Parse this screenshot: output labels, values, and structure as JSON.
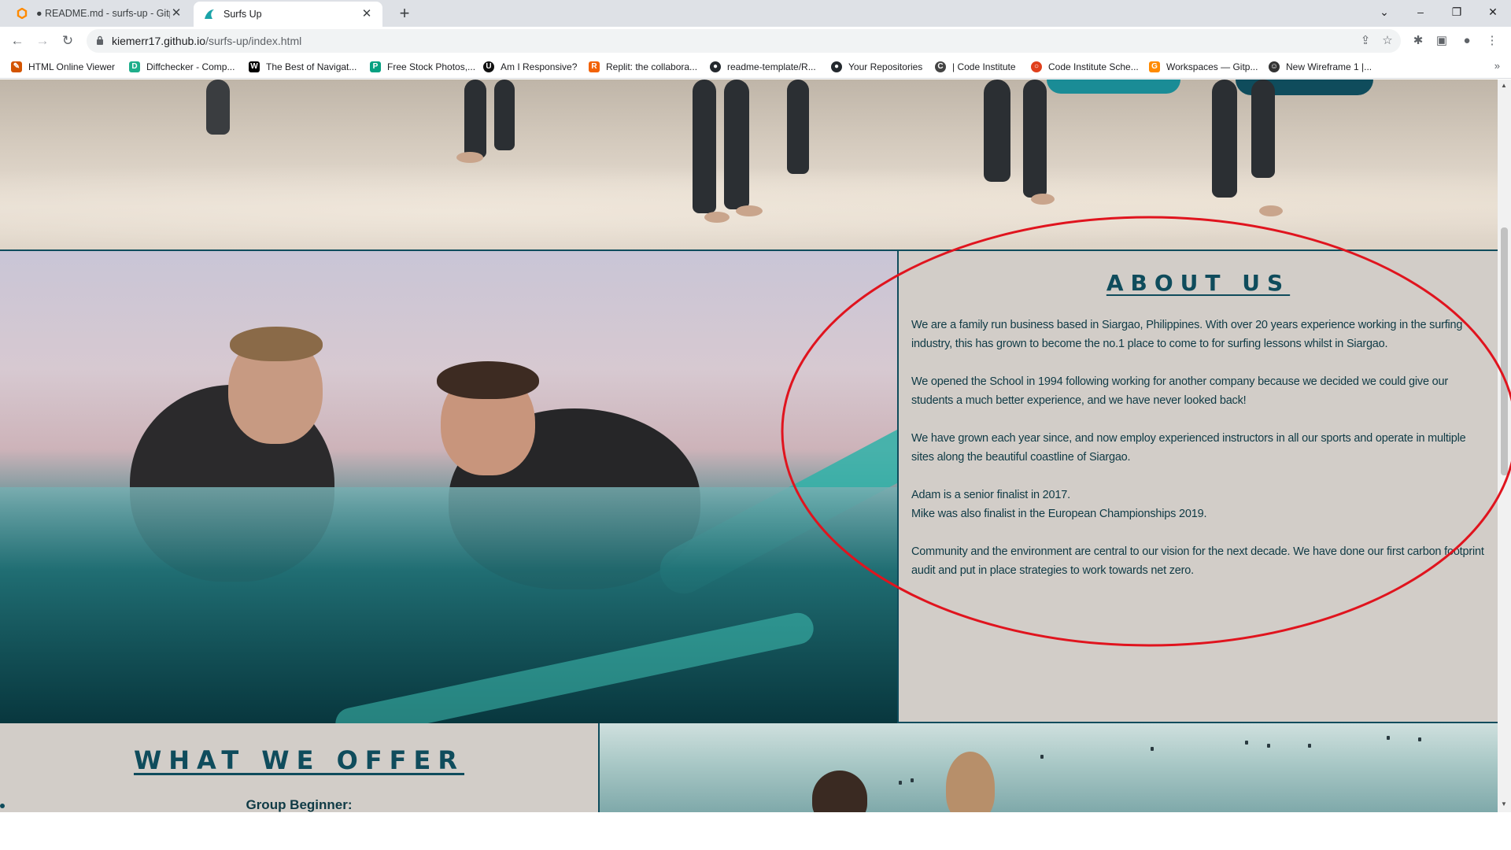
{
  "browser": {
    "tabs": [
      {
        "title": "● README.md - surfs-up - Gitpo",
        "active": false
      },
      {
        "title": "Surfs Up",
        "active": true
      }
    ],
    "url_host": "kiemerr17.github.io",
    "url_path": "/surfs-up/index.html",
    "bookmarks": [
      {
        "label": "HTML Online Viewer",
        "icon_color": "#d35400"
      },
      {
        "label": "Diffchecker - Comp...",
        "icon_color": "#1fae8b"
      },
      {
        "label": "The Best of Navigat...",
        "icon_color": "#000000"
      },
      {
        "label": "Free Stock Photos,...",
        "icon_color": "#05a081"
      },
      {
        "label": "Am I Responsive?",
        "icon_color": "#111111"
      },
      {
        "label": "Replit: the collabora...",
        "icon_color": "#f26207"
      },
      {
        "label": "readme-template/R...",
        "icon_color": "#24292e"
      },
      {
        "label": "Your Repositories",
        "icon_color": "#24292e"
      },
      {
        "label": "| Code Institute",
        "icon_color": "#444444"
      },
      {
        "label": "Code Institute Sche...",
        "icon_color": "#e0401c"
      },
      {
        "label": "Workspaces — Gitp...",
        "icon_color": "#ff8a00"
      },
      {
        "label": "New Wireframe 1 |...",
        "icon_color": "#333333"
      }
    ]
  },
  "about": {
    "heading": "ABOUT US",
    "paragraphs": [
      "We are a family run business based in Siargao, Philippines. With over 20 years experience working in the surfing industry, this has grown to become the no.1 place to come to for surfing lessons whilst in Siargao.",
      "We opened the School in 1994 following working for another company because we decided we could give our students a much better experience, and we have never looked back!",
      "We have grown each year since, and now employ experienced instructors in all our sports and operate in multiple sites along the beautiful coastline of Siargao.",
      "Adam is a senior finalist in 2017.",
      "Mike was also finalist in the European Championships 2019.",
      "Community and the environment are central to our vision for the next decade. We have done our first carbon footprint audit and put in place strategies to work towards net zero."
    ]
  },
  "offer": {
    "heading": "WHAT WE OFFER",
    "first_item": "Group Beginner:"
  },
  "colors": {
    "brand_teal": "#0f4c5c",
    "panel_bg": "#d2cdc8",
    "annotation_red": "#e0141e"
  }
}
